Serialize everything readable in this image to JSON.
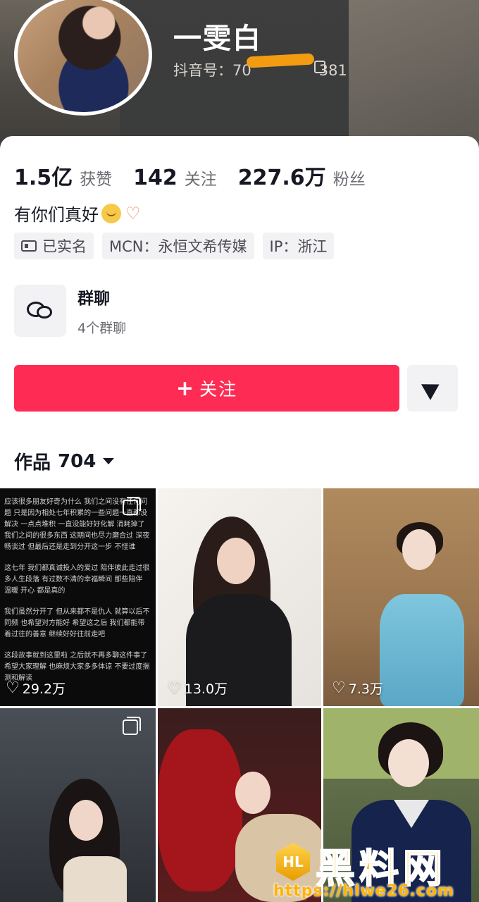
{
  "profile": {
    "nickname": "一雯白",
    "douyin_id_label": "抖音号：",
    "douyin_id_visible": "70",
    "douyin_id_tail": "381"
  },
  "stats": [
    {
      "value": "1.5亿",
      "label": "获赞"
    },
    {
      "value": "142",
      "label": "关注"
    },
    {
      "value": "227.6万",
      "label": "粉丝"
    }
  ],
  "bio": "有你们真好",
  "tags": [
    {
      "icon": "id-card-icon",
      "text": "已实名"
    },
    {
      "text": "MCN：永恒文希传媒"
    },
    {
      "text": "IP：浙江"
    }
  ],
  "group_chat": {
    "title": "群聊",
    "subtitle": "4个群聊"
  },
  "actions": {
    "follow_label": "关注",
    "share_icon": "send-icon"
  },
  "works_tab": {
    "label": "作品",
    "count": "704"
  },
  "grid": [
    {
      "likes": "29.2万",
      "multi": true
    },
    {
      "likes": "13.0万",
      "multi": false
    },
    {
      "likes": "7.3万",
      "multi": false
    },
    {
      "likes": "",
      "multi": true
    },
    {
      "likes": "",
      "multi": false
    },
    {
      "likes": "",
      "multi": false
    }
  ],
  "note_post": {
    "lines": [
      "应该很多朋友好奇为什么 我们之间没有任何问题 只是因为相处七年积累的一些问题一直都没解决 一点点堆积 一直没能好好化解 消耗掉了我们之间的很多东西 这期间也尽力磨合过 深夜畅谈过 但最后还是走到分开这一步 不怪谁",
      "这七年 我们都真诚投入的爱过 陪伴彼此走过很多人生段落 有过数不清的幸福瞬间 那些陪伴 温暖 开心 都是真的",
      "我们虽然分开了 但从来都不是仇人 就算以后不同频 也希望对方能好 希望这之后 我们都能带着过往的善意 继续好好往前走吧",
      "这段故事就到这里啦 之后就不再多聊这件事了 希望大家理解 也麻烦大家多多体谅 不要过度揣测和解读"
    ]
  },
  "watermark": {
    "logo_text": "HL",
    "brand": "黑料网",
    "url": "https://hlwe26.com"
  },
  "colors": {
    "accent": "#fe2c55",
    "watermark": "#ffb300"
  }
}
